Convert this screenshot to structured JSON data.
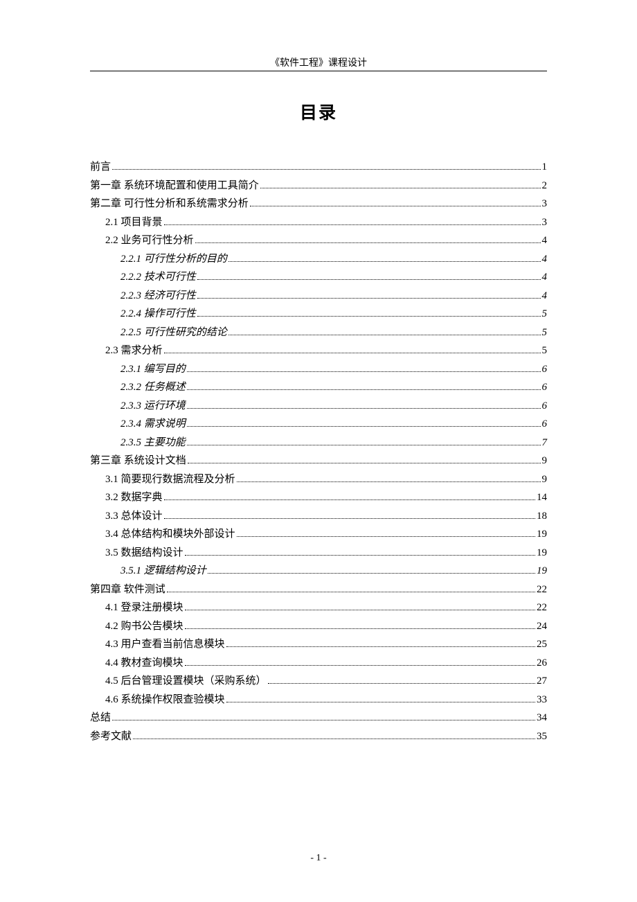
{
  "header": "《软件工程》课程设计",
  "title": "目录",
  "footer": "- 1 -",
  "toc": [
    {
      "level": 0,
      "label": "前言",
      "page": "1",
      "italic": false
    },
    {
      "level": 0,
      "label": "第一章  系统环境配置和使用工具简介",
      "page": "2",
      "italic": false
    },
    {
      "level": 0,
      "label": "第二章  可行性分析和系统需求分析",
      "page": "3",
      "italic": false
    },
    {
      "level": 1,
      "label": "2.1 项目背景",
      "page": "3",
      "italic": false
    },
    {
      "level": 1,
      "label": "2.2 业务可行性分析",
      "page": "4",
      "italic": false
    },
    {
      "level": 2,
      "label": "2.2.1 可行性分析的目的",
      "page": "4",
      "italic": true
    },
    {
      "level": 2,
      "label": "2.2.2 技术可行性",
      "page": "4",
      "italic": true
    },
    {
      "level": 2,
      "label": "2.2.3  经济可行性",
      "page": "4",
      "italic": true
    },
    {
      "level": 2,
      "label": "2.2.4 操作可行性",
      "page": "5",
      "italic": true
    },
    {
      "level": 2,
      "label": "2.2.5 可行性研究的结论",
      "page": "5",
      "italic": true
    },
    {
      "level": 1,
      "label": "2.3 需求分析",
      "page": "5",
      "italic": false
    },
    {
      "level": 2,
      "label": "2.3.1 编写目的",
      "page": "6",
      "italic": true
    },
    {
      "level": 2,
      "label": "2.3.2 任务概述",
      "page": "6",
      "italic": true
    },
    {
      "level": 2,
      "label": "2.3.3  运行环境",
      "page": "6",
      "italic": true
    },
    {
      "level": 2,
      "label": "2.3.4 需求说明",
      "page": "6",
      "italic": true
    },
    {
      "level": 2,
      "label": "2.3.5  主要功能",
      "page": "7",
      "italic": true
    },
    {
      "level": 0,
      "label": "第三章  系统设计文档",
      "page": "9",
      "italic": false
    },
    {
      "level": 1,
      "label": "3.1 简要现行数据流程及分析",
      "page": "9",
      "italic": false
    },
    {
      "level": 1,
      "label": "3.2 数据字典",
      "page": "14",
      "italic": false
    },
    {
      "level": 1,
      "label": "3.3 总体设计",
      "page": "18",
      "italic": false
    },
    {
      "level": 1,
      "label": "3.4  总体结构和模块外部设计",
      "page": "19",
      "italic": false
    },
    {
      "level": 1,
      "label": "3.5 数据结构设计",
      "page": "19",
      "italic": false
    },
    {
      "level": 2,
      "label": "3.5.1 逻辑结构设计",
      "page": "19",
      "italic": true
    },
    {
      "level": 0,
      "label": "第四章  软件测试",
      "page": "22",
      "italic": false
    },
    {
      "level": 1,
      "label": "4.1 登录注册模块",
      "page": "22",
      "italic": false
    },
    {
      "level": 1,
      "label": "4.2 购书公告模块",
      "page": "24",
      "italic": false
    },
    {
      "level": 1,
      "label": "4.3 用户查看当前信息模块",
      "page": "25",
      "italic": false
    },
    {
      "level": 1,
      "label": "4.4  教材查询模块",
      "page": "26",
      "italic": false
    },
    {
      "level": 1,
      "label": "4.5  后台管理设置模块（采购系统）",
      "page": "27",
      "italic": false
    },
    {
      "level": 1,
      "label": "4.6 系统操作权限查验模块",
      "page": "33",
      "italic": false
    },
    {
      "level": 0,
      "label": "总结",
      "page": "34",
      "italic": false
    },
    {
      "level": 0,
      "label": "参考文献",
      "page": "35",
      "italic": false
    }
  ]
}
